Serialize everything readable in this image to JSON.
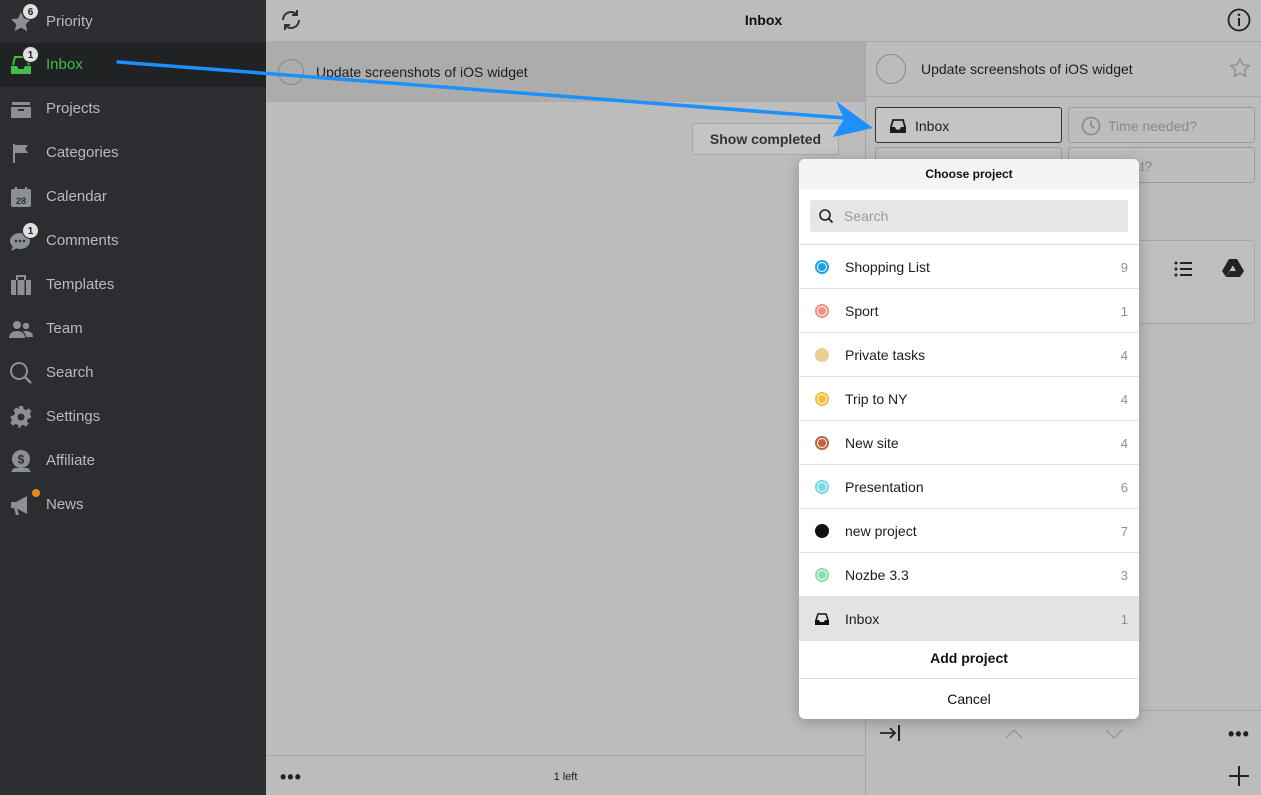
{
  "sidebar": {
    "items": [
      {
        "label": "Priority",
        "icon": "star-icon",
        "badge": "6"
      },
      {
        "label": "Inbox",
        "icon": "inbox-icon",
        "badge": "1",
        "active": true
      },
      {
        "label": "Projects",
        "icon": "projects-icon"
      },
      {
        "label": "Categories",
        "icon": "flag-icon"
      },
      {
        "label": "Calendar",
        "icon": "calendar-icon",
        "icon_text": "28"
      },
      {
        "label": "Comments",
        "icon": "comments-icon",
        "badge": "1"
      },
      {
        "label": "Templates",
        "icon": "templates-icon"
      },
      {
        "label": "Team",
        "icon": "team-icon"
      },
      {
        "label": "Search",
        "icon": "search-icon"
      },
      {
        "label": "Settings",
        "icon": "gear-icon"
      },
      {
        "label": "Affiliate",
        "icon": "dollar-icon"
      },
      {
        "label": "News",
        "icon": "megaphone-icon",
        "dot": true
      }
    ]
  },
  "header": {
    "title": "Inbox"
  },
  "task_list": {
    "tasks": [
      {
        "title": "Update screenshots of iOS widget"
      }
    ],
    "show_completed_label": "Show completed",
    "footer_count": "1 left"
  },
  "detail": {
    "task_title": "Update screenshots of iOS widget",
    "project_button": "Inbox",
    "time_needed_placeholder": "Time needed?",
    "what_placeholder": "...at?"
  },
  "project_picker": {
    "title": "Choose project",
    "search_placeholder": "Search",
    "projects": [
      {
        "name": "Shopping List",
        "count": "9",
        "color": "#1fa0e8",
        "ring": true
      },
      {
        "name": "Sport",
        "count": "1",
        "color": "#f0907e",
        "ring": true
      },
      {
        "name": "Private tasks",
        "count": "4",
        "color": "#ebcf96"
      },
      {
        "name": "Trip to NY",
        "count": "4",
        "color": "#f5be3c",
        "ring": true
      },
      {
        "name": "New site",
        "count": "4",
        "color": "#c0643a",
        "ring": true
      },
      {
        "name": "Presentation",
        "count": "6",
        "color": "#79d6e6",
        "ring": true
      },
      {
        "name": "new project",
        "count": "7",
        "color": "#111111"
      },
      {
        "name": "Nozbe 3.3",
        "count": "3",
        "color": "#86e0a8",
        "ring": true
      },
      {
        "name": "Inbox",
        "count": "1",
        "icon": "inbox-icon",
        "selected": true
      }
    ],
    "add_label": "Add project",
    "cancel_label": "Cancel"
  },
  "colors": {
    "sidebar_bg": "#2b2d30",
    "active_green": "#3fbf45",
    "annotation_arrow": "#1e8fff",
    "news_dot": "#e58a1f"
  }
}
